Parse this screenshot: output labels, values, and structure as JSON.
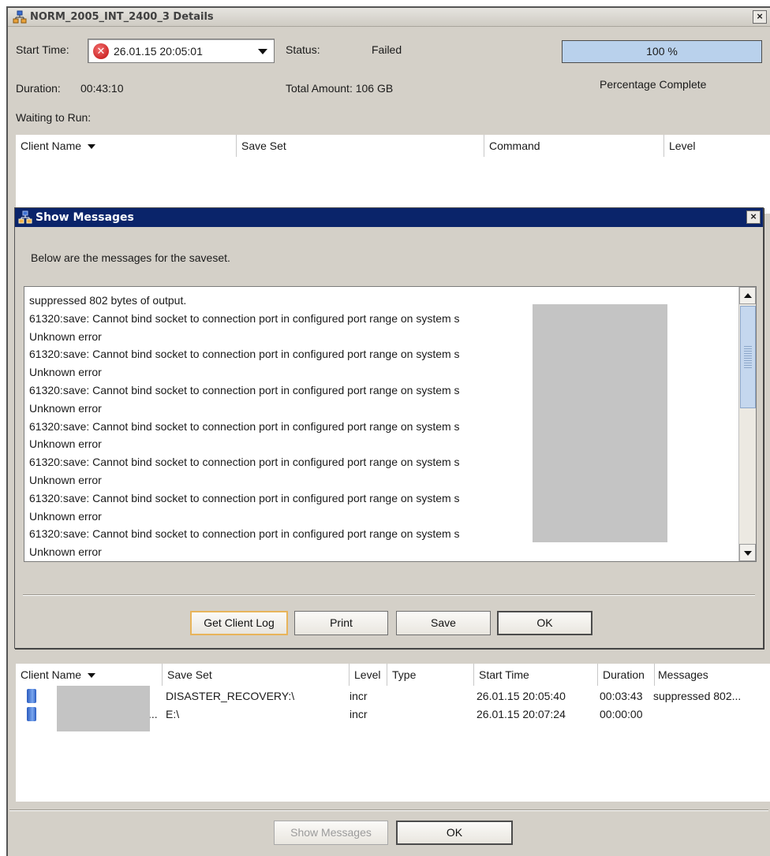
{
  "window": {
    "title": "NORM_2005_INT_2400_3 Details",
    "close_glyph": "×"
  },
  "details": {
    "start_time_label": "Start Time:",
    "start_time_value": "26.01.15 20:05:01",
    "status_label": "Status:",
    "status_value": "Failed",
    "progress_text": "100 %",
    "progress_fraction": 1.0,
    "percentage_label": "Percentage Complete",
    "duration_label": "Duration:",
    "duration_value": "00:43:10",
    "total_amount": "Total Amount: 106 GB",
    "waiting_label": "Waiting to Run:"
  },
  "waiting_table": {
    "columns": [
      "Client Name",
      "Save Set",
      "Command",
      "Level"
    ]
  },
  "dialog": {
    "title": "Show Messages",
    "close_glyph": "×",
    "intro": "Below are the messages for the saveset.",
    "lines": [
      "suppressed 802 bytes of output.",
      "61320:save: Cannot bind socket to connection port in configured port range on system s",
      "Unknown error",
      "61320:save: Cannot bind socket to connection port in configured port range on system s",
      "Unknown error",
      "61320:save: Cannot bind socket to connection port in configured port range on system s",
      "Unknown error",
      "61320:save: Cannot bind socket to connection port in configured port range on system s",
      "Unknown error",
      "61320:save: Cannot bind socket to connection port in configured port range on system s",
      "Unknown error",
      "61320:save: Cannot bind socket to connection port in configured port range on system s",
      "Unknown error",
      "61320:save: Cannot bind socket to connection port in configured port range on system s",
      "Unknown error"
    ],
    "buttons": {
      "get_client_log": "Get Client Log",
      "print": "Print",
      "save": "Save",
      "ok": "OK"
    }
  },
  "completed_table": {
    "columns": [
      "Client Name",
      "Save Set",
      "Level",
      "Type",
      "Start Time",
      "Duration",
      "Messages"
    ],
    "rows": [
      {
        "client": "",
        "save_set": "DISASTER_RECOVERY:\\",
        "level": "incr",
        "type": "",
        "start_time": "26.01.15 20:05:40",
        "duration": "00:03:43",
        "messages": "suppressed 802..."
      },
      {
        "client": "...",
        "save_set": "E:\\",
        "level": "incr",
        "type": "",
        "start_time": "26.01.15 20:07:24",
        "duration": "00:00:00",
        "messages": ""
      }
    ]
  },
  "footer": {
    "show_messages": "Show Messages",
    "ok": "OK"
  },
  "icons": {
    "window": "network-nodes-icon",
    "error": "error-x-icon",
    "client": "client-machine-icon"
  }
}
